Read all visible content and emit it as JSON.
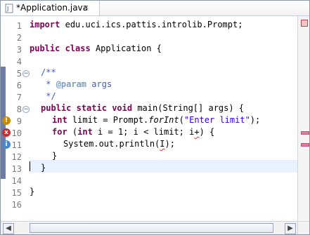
{
  "tab": {
    "title": "*Application.java",
    "close_label": "×"
  },
  "editor": {
    "line_numbers": [
      "1",
      "2",
      "3",
      "4",
      "5",
      "6",
      "7",
      "8",
      "9",
      "10",
      "11",
      "12",
      "13",
      "14",
      "15",
      "16"
    ],
    "lines": {
      "l1": "import edu.uci.ics.pattis.introlib.Prompt;",
      "l3": "public class Application {",
      "l5": "/**",
      "l6": " * @param args",
      "l7": " */",
      "l8a": "public static void main(String[] args) {",
      "l9": "int limit = Prompt.forInt(\"Enter limit\");",
      "l10": "for (int i = 1; i < limit; i+) {",
      "l11": "System.out.println(I);",
      "l12": "}",
      "l13": "}",
      "l15": "}"
    }
  },
  "markers": {
    "warning": "!",
    "error": "x",
    "info": "i"
  },
  "scrollbar": {
    "left": "◀",
    "right": "▶"
  },
  "colors": {
    "keyword": "#7f0055",
    "comment": "#3f5fbf",
    "string": "#2a00ff",
    "line_highlight": "#e8f2fe"
  }
}
